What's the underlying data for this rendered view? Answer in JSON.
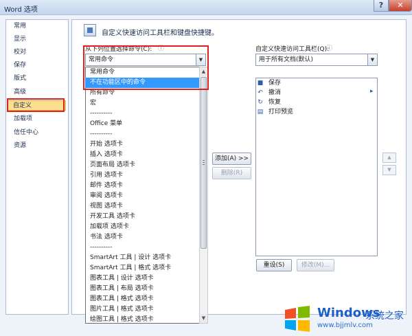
{
  "window": {
    "title": "Word 选项",
    "help_glyph": "?",
    "close_glyph": "✕"
  },
  "nav": {
    "items": [
      {
        "label": "常用",
        "selected": false
      },
      {
        "label": "显示",
        "selected": false
      },
      {
        "label": "校对",
        "selected": false
      },
      {
        "label": "保存",
        "selected": false
      },
      {
        "label": "版式",
        "selected": false
      },
      {
        "label": "高级",
        "selected": false
      },
      {
        "label": "自定义",
        "selected": true
      },
      {
        "label": "加载项",
        "selected": false
      },
      {
        "label": "信任中心",
        "selected": false
      },
      {
        "label": "资源",
        "selected": false
      }
    ]
  },
  "main": {
    "heading": "自定义快速访问工具栏和键盘快捷键。",
    "choose_from_label": "从下列位置选择命令(C):",
    "choose_from_value": "常用命令",
    "dropdown_options": [
      "常用命令",
      "不在功能区中的命令",
      "所有命令",
      "宏",
      "----------",
      "Office 菜单",
      "----------",
      "开始 选项卡",
      "插入 选项卡",
      "页面布局 选项卡",
      "引用 选项卡",
      "邮件 选项卡",
      "审阅 选项卡",
      "视图 选项卡",
      "开发工具 选项卡",
      "加载项 选项卡",
      "书法 选项卡",
      "----------",
      "SmartArt 工具 | 设计 选项卡",
      "SmartArt 工具 | 格式 选项卡",
      "图表工具 | 设计 选项卡",
      "图表工具 | 布局 选项卡",
      "图表工具 | 格式 选项卡",
      "图片工具 | 格式 选项卡",
      "绘图工具 | 格式 选项卡"
    ],
    "highlighted_option": "不在功能区中的命令",
    "add_button": "添加(A) >>",
    "remove_button": "删除(R)",
    "qa_label": "自定义快速访问工具栏(Q):",
    "qa_value": "用于所有文档(默认)",
    "qa_items": [
      {
        "label": "保存",
        "icon": "save-icon",
        "glyph": "■"
      },
      {
        "label": "撤消",
        "icon": "undo-icon",
        "glyph": "↶"
      },
      {
        "label": "恢复",
        "icon": "redo-icon",
        "glyph": "↻"
      },
      {
        "label": "打印预览",
        "icon": "print-preview-icon",
        "glyph": "▤"
      }
    ],
    "reset_button": "重设(S)",
    "modify_button": "修改(M)...",
    "info_glyph": "ⓘ",
    "arrow_down": "▼",
    "arrow_up": "▲",
    "arrow_right": "▸"
  },
  "watermark": {
    "brand": "Windows",
    "suffix": "系统之家",
    "url": "www.bjjmlv.com"
  },
  "colors": {
    "highlight": "#3399ff",
    "selected_nav": "#fde08f",
    "red_box": "#e02020"
  }
}
